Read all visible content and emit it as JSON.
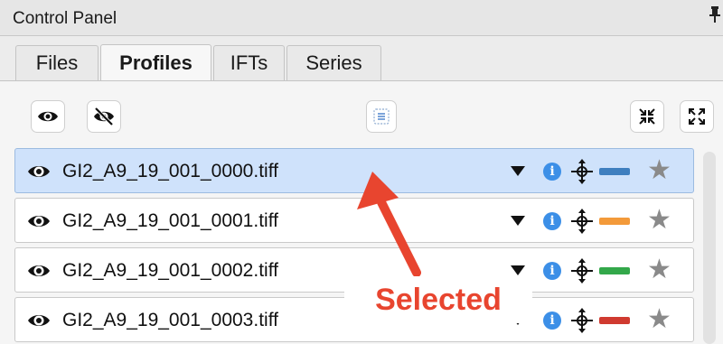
{
  "window": {
    "title": "Control Panel",
    "pin_icon": "pin-icon"
  },
  "tabs": [
    {
      "label": "Files",
      "active": false
    },
    {
      "label": "Profiles",
      "active": true
    },
    {
      "label": "IFTs",
      "active": false
    },
    {
      "label": "Series",
      "active": false
    }
  ],
  "toolbar": {
    "buttons": [
      {
        "name": "show-all-button",
        "icon": "eye-icon"
      },
      {
        "name": "hide-all-button",
        "icon": "eye-slash-icon"
      },
      {
        "name": "select-all-button",
        "icon": "list-icon"
      },
      {
        "name": "collapse-all-button",
        "icon": "collapse-icon"
      },
      {
        "name": "expand-all-button",
        "icon": "expand-icon"
      }
    ]
  },
  "profiles": [
    {
      "filename": "GI2_A9_19_001_0000.tiff",
      "color": "#3f7fbf",
      "selected": true
    },
    {
      "filename": "GI2_A9_19_001_0001.tiff",
      "color": "#f39a3a",
      "selected": false
    },
    {
      "filename": "GI2_A9_19_001_0002.tiff",
      "color": "#33a84a",
      "selected": false
    },
    {
      "filename": "GI2_A9_19_001_0003.tiff",
      "color": "#d03a30",
      "selected": false
    }
  ],
  "annotation": {
    "label": "Selected",
    "color": "#e8452f"
  }
}
